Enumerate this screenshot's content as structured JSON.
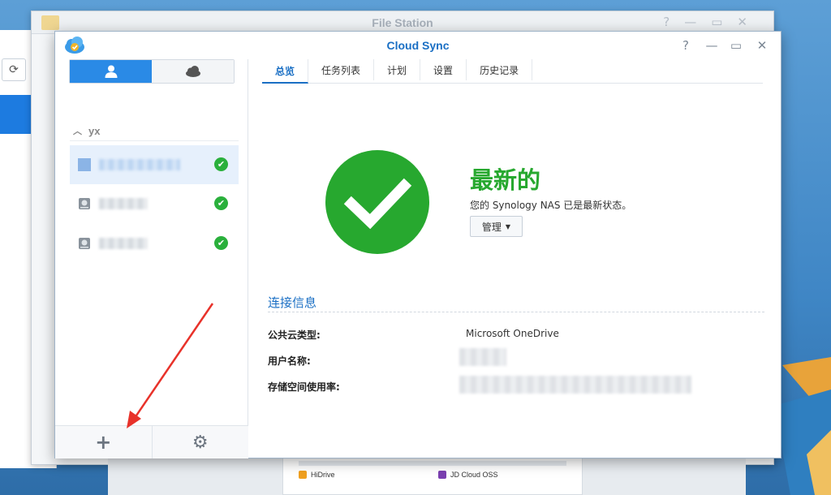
{
  "background": {
    "file_station_title": "File Station",
    "bottom_items": [
      {
        "label": "HiDrive",
        "color": "#f0a020"
      },
      {
        "label": "JD Cloud OSS",
        "color": "#7a3fb0"
      }
    ]
  },
  "window": {
    "title": "Cloud Sync",
    "controls": {
      "help": "?",
      "minimize": "—",
      "maximize": "▭",
      "close": "✕"
    }
  },
  "sidebar": {
    "group_label": "yx",
    "footer": {
      "add": "+",
      "settings": "⚙"
    }
  },
  "tabs": [
    "总览",
    "任务列表",
    "计划",
    "设置",
    "历史记录"
  ],
  "status": {
    "title": "最新的",
    "description": "您的 Synology NAS 已是最新状态。",
    "manage_label": "管理"
  },
  "connection_info": {
    "section_title": "连接信息",
    "rows": [
      {
        "label": "公共云类型:",
        "value": "Microsoft OneDrive"
      },
      {
        "label": "用户名称:",
        "value": ""
      },
      {
        "label": "存储空间使用率:",
        "value": ""
      }
    ]
  },
  "colors": {
    "accent": "#1a6fc4",
    "success": "#27a82f",
    "annotation_arrow": "#e8322a"
  }
}
